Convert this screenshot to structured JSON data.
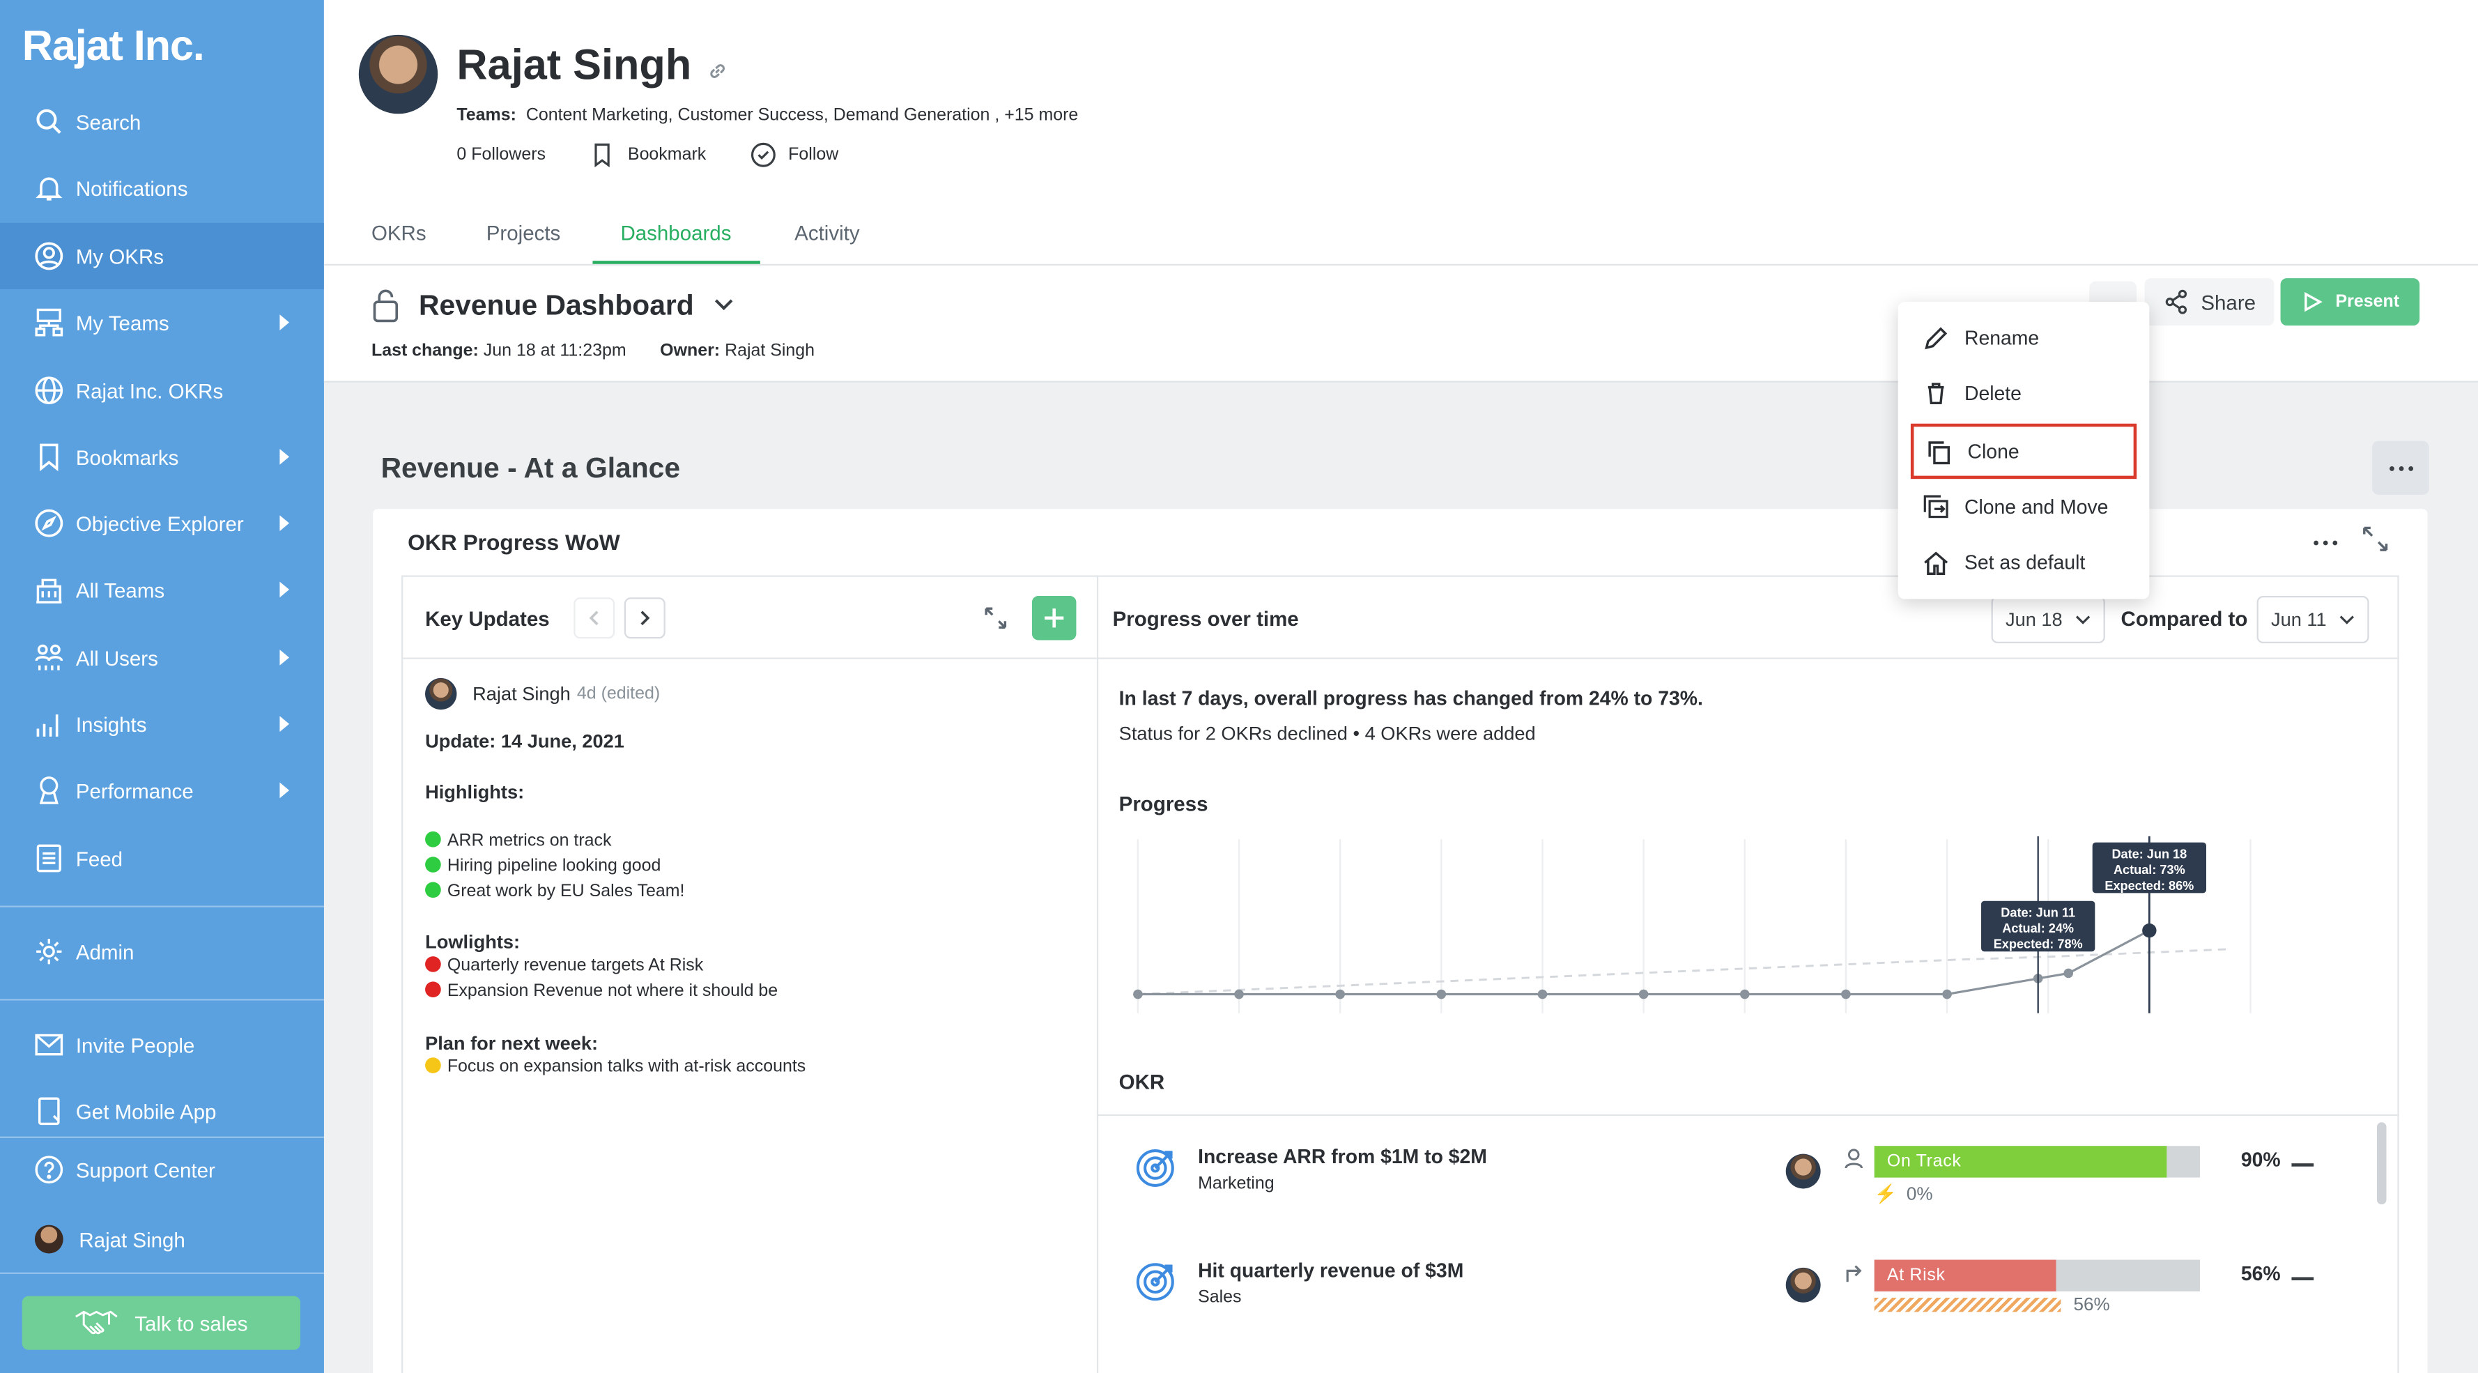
{
  "sidebar": {
    "brand": "Rajat Inc.",
    "items": [
      {
        "label": "Search",
        "icon": "search-icon"
      },
      {
        "label": "Notifications",
        "icon": "bell-icon"
      },
      {
        "label": "My OKRs",
        "icon": "user-circle-icon"
      },
      {
        "label": "My Teams",
        "icon": "org-chart-icon"
      },
      {
        "label": "Rajat Inc. OKRs",
        "icon": "globe-icon"
      },
      {
        "label": "Bookmarks",
        "icon": "bookmark-icon"
      },
      {
        "label": "Objective Explorer",
        "icon": "compass-icon"
      },
      {
        "label": "All Teams",
        "icon": "building-icon"
      },
      {
        "label": "All Users",
        "icon": "users-icon"
      },
      {
        "label": "Insights",
        "icon": "bar-chart-icon"
      },
      {
        "label": "Performance",
        "icon": "award-icon"
      },
      {
        "label": "Feed",
        "icon": "feed-icon"
      },
      {
        "label": "Admin",
        "icon": "gear-icon"
      },
      {
        "label": "Invite People",
        "icon": "mail-icon"
      },
      {
        "label": "Get Mobile App",
        "icon": "mobile-icon"
      },
      {
        "label": "Support Center",
        "icon": "help-icon"
      },
      {
        "label": "Rajat Singh",
        "icon": "avatar"
      }
    ],
    "talk_to_sales": "Talk to sales"
  },
  "profile": {
    "name": "Rajat Singh",
    "teams_label": "Teams:",
    "teams": "Content Marketing, Customer Success, Demand Generation",
    "teams_more": ",  +15 more",
    "followers": "0 Followers",
    "bookmark": "Bookmark",
    "follow": "Follow"
  },
  "tabs": [
    "OKRs",
    "Projects",
    "Dashboards",
    "Activity"
  ],
  "dashboard": {
    "title": "Revenue Dashboard",
    "last_change_label": "Last change:",
    "last_change": "Jun 18 at 11:23pm",
    "owner_label": "Owner:",
    "owner": "Rajat Singh",
    "share": "Share",
    "present": "Present"
  },
  "menu": {
    "items": [
      "Rename",
      "Delete",
      "Clone",
      "Clone and Move",
      "Set as default"
    ],
    "highlighted": "Clone"
  },
  "section": {
    "title": "Revenue - At a Glance",
    "card_title": "OKR Progress WoW"
  },
  "key_updates": {
    "title": "Key Updates",
    "author": "Rajat Singh",
    "time": "4d (edited)",
    "update_date": "Update: 14 June, 2021",
    "highlights_label": "Highlights:",
    "highlights": [
      "ARR metrics on track",
      "Hiring pipeline looking good",
      "Great work by EU Sales Team!"
    ],
    "lowlights_label": "Lowlights:",
    "lowlights": [
      "Quarterly revenue targets At Risk",
      "Expansion Revenue not where it should be"
    ],
    "plan_label": "Plan for next week:",
    "plan": [
      "Focus on expansion talks with at-risk accounts"
    ]
  },
  "progress": {
    "title": "Progress over time",
    "date": "Jun 18",
    "compared_label": "Compared to",
    "compared_date": "Jun 11",
    "summary": "In last 7 days, overall progress has changed from 24% to 73%.",
    "summary2": "Status for 2 OKRs declined • 4 OKRs were added",
    "chart_label": "Progress",
    "tooltip_jun11": [
      "Date: Jun 11",
      "Actual: 24%",
      "Expected: 78%"
    ],
    "tooltip_jun18": [
      "Date: Jun 18",
      "Actual: 73%",
      "Expected: 86%"
    ],
    "okr_label": "OKR"
  },
  "chart_data": {
    "type": "line",
    "series": [
      {
        "values": [
          0,
          0,
          0,
          0,
          0,
          0,
          0,
          0,
          0,
          18,
          24,
          73
        ]
      },
      {
        "values": [
          0,
          8,
          16,
          24,
          32,
          40,
          48,
          56,
          64,
          72,
          78,
          86,
          94
        ]
      }
    ],
    "annotations": [
      {
        "date": "Jun 11",
        "actual": 24,
        "expected": 78
      },
      {
        "date": "Jun 18",
        "actual": 73,
        "expected": 86
      }
    ],
    "grid": true
  },
  "okrs": [
    {
      "name": "Increase ARR from $1M to $2M",
      "team": "Marketing",
      "status": "On Track",
      "progress": 90,
      "pct": "90%",
      "sub": "0%",
      "color": "#7fcf3c"
    },
    {
      "name": "Hit quarterly revenue of $3M",
      "team": "Sales",
      "status": "At Risk",
      "progress": 56,
      "pct": "56%",
      "sub": "56%",
      "color": "#e0716b"
    }
  ],
  "colors": {
    "sidebar": "#5ba1e0",
    "accent": "#27ae60",
    "present": "#5cc58a",
    "highlight": "#d93a2b"
  }
}
